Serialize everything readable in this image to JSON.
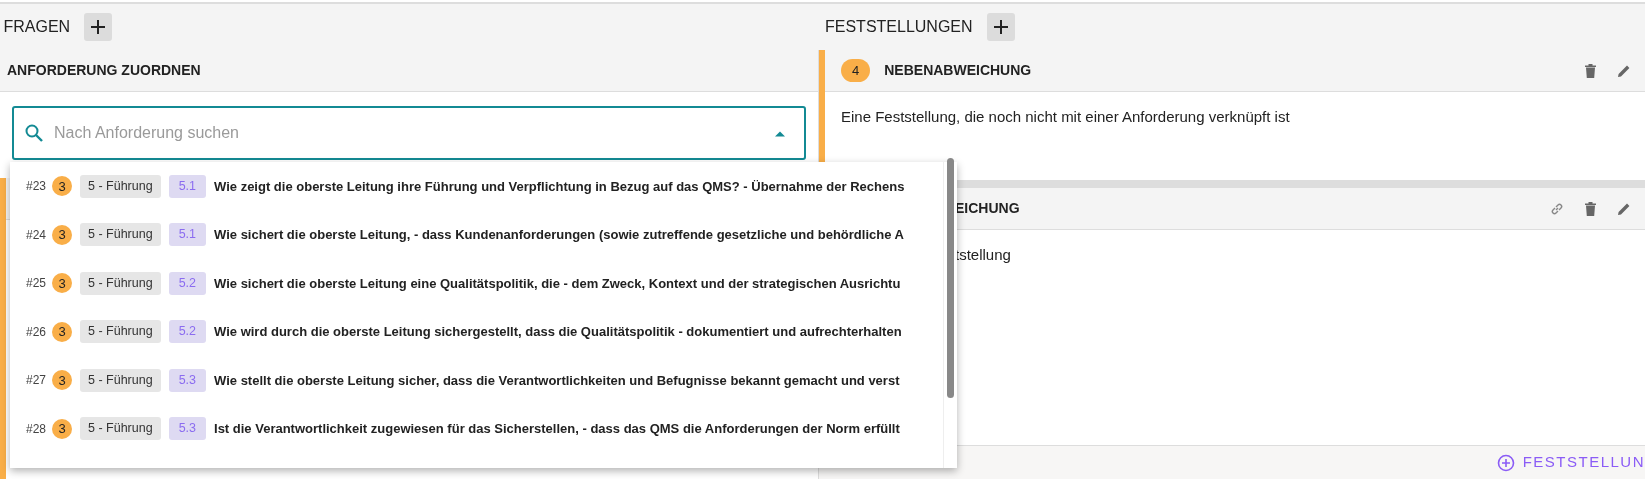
{
  "questions_panel": {
    "title": "FRAGEN"
  },
  "requirement_card": {
    "title": "ANFORDERUNG ZUORDNEN",
    "search": {
      "placeholder": "Nach Anforderung suchen",
      "expanded": true
    }
  },
  "dropdown": {
    "options": [
      {
        "number": "#23",
        "count": "3",
        "chapter": "5 - Führung",
        "clause": "5.1",
        "text": "Wie zeigt die oberste Leitung ihre Führung und Verpflichtung in Bezug auf das QMS? - Übernahme der Rechens"
      },
      {
        "number": "#24",
        "count": "3",
        "chapter": "5 - Führung",
        "clause": "5.1",
        "text": "Wie sichert die oberste Leitung, - dass Kundenanforderungen (sowie zutreffende gesetzliche und behördliche A"
      },
      {
        "number": "#25",
        "count": "3",
        "chapter": "5 - Führung",
        "clause": "5.2",
        "text": "Wie sichert die oberste Leitung eine Qualitätspolitik, die - dem Zweck, Kontext und der strategischen Ausrichtu"
      },
      {
        "number": "#26",
        "count": "3",
        "chapter": "5 - Führung",
        "clause": "5.2",
        "text": "Wie wird durch die oberste Leitung sichergestellt, dass die Qualitätspolitik - dokumentiert und aufrechterhalten"
      },
      {
        "number": "#27",
        "count": "3",
        "chapter": "5 - Führung",
        "clause": "5.3",
        "text": "Wie stellt die oberste Leitung sicher, dass die Verantwortlichkeiten und Befugnisse bekannt gemacht und verst"
      },
      {
        "number": "#28",
        "count": "3",
        "chapter": "5 - Führung",
        "clause": "5.3",
        "text": "Ist die Verantwortlichkeit zugewiesen für das Sicherstellen, - dass das QMS die Anforderungen der Norm erfüllt"
      }
    ]
  },
  "findings_panel": {
    "title": "FESTSTELLUNGEN"
  },
  "findings": [
    {
      "count": "4",
      "title": "NEBENABWEICHUNG",
      "description": "Eine Feststellung, die noch nicht mit einer Anforderung verknüpft ist",
      "linkable": false
    },
    {
      "title": "EICHUNG",
      "description": "tstellung",
      "linkable": true
    }
  ],
  "add_finding_button": "FESTSTELLUN"
}
